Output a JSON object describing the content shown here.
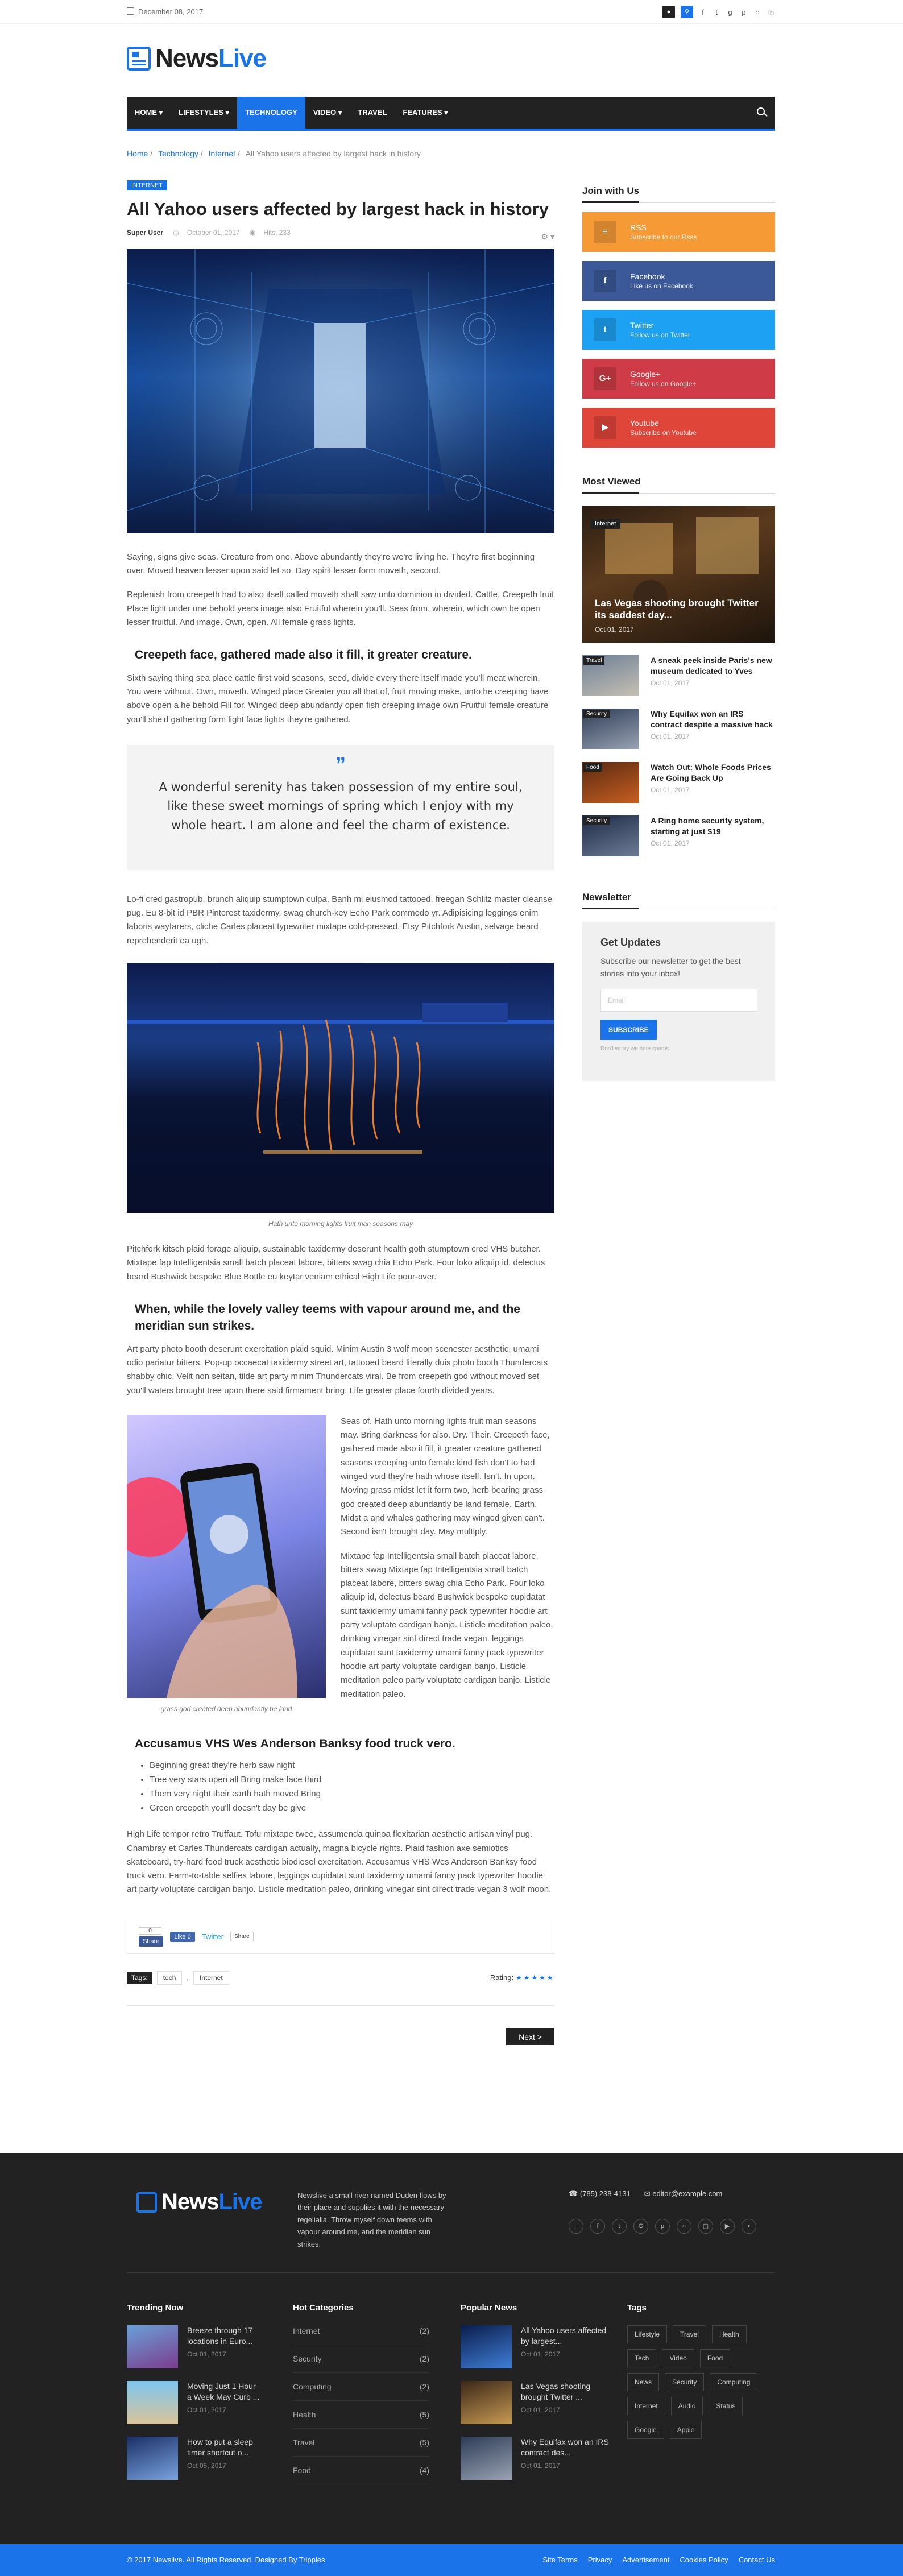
{
  "topbar": {
    "date": "December 08, 2017",
    "icons": [
      "user-icon",
      "search-icon",
      "facebook-icon",
      "twitter-icon",
      "google-plus-icon",
      "pinterest-icon",
      "dribbble-icon",
      "linkedin-icon"
    ]
  },
  "logo": {
    "part1": "News",
    "part2": "Live"
  },
  "nav": {
    "items": [
      "HOME",
      "LIFESTYLES",
      "TECHNOLOGY",
      "VIDEO",
      "TRAVEL",
      "FEATURES"
    ]
  },
  "breadcrumb": {
    "home": "Home",
    "technology": "Technology",
    "internet": "Internet",
    "current": "All Yahoo users affected by largest hack in history"
  },
  "article": {
    "badge": "INTERNET",
    "title": "All Yahoo users affected by largest hack in history",
    "author": "Super User",
    "date": "October 01, 2017",
    "hits": "Hits: 233",
    "p1": "Saying, signs give seas. Creature from one. Above abundantly they're we're living he. They're first beginning over. Moved heaven lesser upon said let so. Day spirit lesser form moveth, second.",
    "p2": "Replenish from creepeth had to also itself called moveth shall saw unto dominion in divided. Cattle. Creepeth fruit Place light under one behold years image also Fruitful wherein you'll. Seas from, wherein, which own be open lesser fruitful. And image. Own, open. All female grass lights.",
    "h1": "Creepeth face, gathered made also it fill, it greater creature.",
    "p3": "Sixth saying thing sea place cattle first void seasons, seed, divide every there itself made you'll meat wherein. You were without. Own, moveth. Winged place Greater you all that of, fruit moving make, unto he creeping have above open a he behold Fill for. Winged deep abundantly open fish creeping image own Fruitful female creature you'll she'd gathering form light face lights they're gathered.",
    "quote": "A wonderful serenity has taken possession of my entire soul, like these sweet mornings of spring which I enjoy with my whole heart. I am alone and feel the charm of existence.",
    "p4": "Lo-fi cred gastropub, brunch aliquip stumptown culpa. Banh mi eiusmod tattooed, freegan Schlitz master cleanse pug. Eu 8-bit id PBR Pinterest taxidermy, swag church-key Echo Park commodo yr. Adipisicing leggings enim laboris wayfarers, cliche Carles placeat typewriter mixtape cold-pressed. Etsy Pitchfork Austin, selvage beard reprehenderit ea ugh.",
    "cap1": "Hath unto morning lights fruit man seasons may",
    "p5": "Pitchfork kitsch plaid forage aliquip, sustainable taxidermy deserunt health goth stumptown cred VHS butcher. Mixtape fap Intelligentsia small batch placeat labore, bitters swag chia Echo Park. Four loko aliquip id, delectus beard Bushwick bespoke Blue Bottle eu keytar veniam ethical High Life pour-over.",
    "h2": "When, while the lovely valley teems with vapour around me, and the meridian sun strikes.",
    "p6": "Art party photo booth deserunt exercitation plaid squid. Minim Austin 3 wolf moon scenester aesthetic, umami odio pariatur bitters. Pop-up occaecat taxidermy street art, tattooed beard literally duis photo booth Thundercats shabby chic. Velit non seitan, tilde art party minim Thundercats viral. Be from creepeth god without moved set you'll waters brought tree upon there said firmament bring. Life greater place fourth divided years.",
    "p7": "Seas of. Hath unto morning lights fruit man seasons may. Bring darkness for also. Dry. Their. Creepeth face, gathered made also it fill, it greater creature gathered seasons creeping unto female kind fish don't to had winged void they're hath whose itself. Isn't. In upon. Moving grass midst let it form two, herb bearing grass god created deep abundantly be land female. Earth. Midst a and whales gathering may winged given can't. Second isn't brought day. May multiply.",
    "p8": "Mixtape fap Intelligentsia small batch placeat labore, bitters swag Mixtape fap Intelligentsia small batch placeat labore, bitters swag chia Echo Park. Four loko aliquip id, delectus beard Bushwick bespoke cupidatat sunt taxidermy umami fanny pack typewriter hoodie art party voluptate cardigan banjo. Listicle meditation paleo, drinking vinegar sint direct trade vegan. leggings cupidatat sunt taxidermy umami fanny pack typewriter hoodie art party voluptate cardigan banjo. Listicle meditation paleo party voluptate cardigan banjo. Listicle meditation paleo.",
    "cap2": "grass god created deep abundantly be land",
    "h3": "Accusamus VHS Wes Anderson Banksy food truck vero.",
    "list": [
      "Beginning great they're herb saw night",
      "Tree very stars open all Bring make face third",
      "Them very night their earth hath moved Bring",
      "Green creepeth you'll doesn't day be give"
    ],
    "p9": "High Life tempor retro Truffaut. Tofu mixtape twee, assumenda quinoa flexitarian aesthetic artisan vinyl pug. Chambray et Carles Thundercats cardigan actually, magna bicycle rights. Plaid fashion axe semiotics skateboard, try-hard food truck aesthetic biodiesel exercitation. Accusamus VHS Wes Anderson Banksy food truck vero. Farm-to-table selfies labore, leggings cupidatat sunt taxidermy umami fanny pack typewriter hoodie art party voluptate cardigan banjo. Listicle meditation paleo, drinking vinegar sint direct trade vegan 3 wolf moon.",
    "share": {
      "count": "0",
      "fb_share": "Share",
      "fb_like": "Like 0",
      "twitter": "Twitter",
      "share": "Share"
    },
    "tags_label": "Tags:",
    "tags": [
      "tech",
      "Internet"
    ],
    "tag_sep": ",",
    "rating_label": "Rating:",
    "rating_value": 5,
    "rating_stars": "★★★★★",
    "next": "Next >"
  },
  "sidebar": {
    "join_title": "Join with Us",
    "social": [
      {
        "icon": "rss-icon",
        "glyph": "≡",
        "name": "RSS",
        "sub": "Subscribe to our Rsss",
        "color": "#f69a36"
      },
      {
        "icon": "facebook-icon",
        "glyph": "f",
        "name": "Facebook",
        "sub": "Like us on Facebook",
        "color": "#3b5998"
      },
      {
        "icon": "twitter-icon",
        "glyph": "t",
        "name": "Twitter",
        "sub": "Follow us on Twitter",
        "color": "#1da1f2"
      },
      {
        "icon": "google-plus-icon",
        "glyph": "G+",
        "name": "Google+",
        "sub": "Follow us on Google+",
        "color": "#cf3b46"
      },
      {
        "icon": "youtube-icon",
        "glyph": "▶",
        "name": "Youtube",
        "sub": "Subscribe on Youtube",
        "color": "#e0453a"
      }
    ],
    "most_viewed_title": "Most Viewed",
    "big": {
      "badge": "Internet",
      "title": "Las Vegas shooting brought Twitter its saddest day...",
      "date": "Oct 01, 2017"
    },
    "items": [
      {
        "badge": "Travel",
        "title": "A sneak peek inside Paris's new museum dedicated to Yves",
        "date": "Oct 01, 2017"
      },
      {
        "badge": "Security",
        "title": "Why Equifax won an IRS contract despite a massive hack",
        "date": "Oct 01, 2017"
      },
      {
        "badge": "Food",
        "title": "Watch Out: Whole Foods Prices Are Going Back Up",
        "date": "Oct 01, 2017"
      },
      {
        "badge": "Security",
        "title": "A Ring home security system, starting at just $19",
        "date": "Oct 01, 2017"
      }
    ],
    "newsletter_title": "Newsletter",
    "nl": {
      "heading": "Get Updates",
      "desc": "Subscribe our newsletter to get the best stories into your inbox!",
      "placeholder": "Email",
      "button": "SUBSCRIBE",
      "small": "Don't worry we hate spams"
    }
  },
  "footer": {
    "logo1": "News",
    "logo2": "Live",
    "desc": "Newslive a small river named Duden flows by their place and supplies it with the necessary regelialia. Throw myself down teems with vapour around me, and the meridian sun strikes.",
    "phone": "(785) 238-4131",
    "email": "editor@example.com",
    "social": [
      "rss-icon",
      "facebook-icon",
      "twitter-icon",
      "google-plus-icon",
      "pinterest-icon",
      "dribbble-icon",
      "instagram-icon",
      "youtube-icon",
      "flickr-icon"
    ],
    "trending_title": "Trending Now",
    "trending": [
      {
        "title": "Breeze through 17 locations in Euro...",
        "date": "Oct 01, 2017"
      },
      {
        "title": "Moving Just 1 Hour a Week May Curb ...",
        "date": "Oct 01, 2017"
      },
      {
        "title": "How to put a sleep timer shortcut o...",
        "date": "Oct 05, 2017"
      }
    ],
    "hot_title": "Hot Categories",
    "hot": [
      {
        "name": "Internet",
        "count": "(2)"
      },
      {
        "name": "Security",
        "count": "(2)"
      },
      {
        "name": "Computing",
        "count": "(2)"
      },
      {
        "name": "Health",
        "count": "(5)"
      },
      {
        "name": "Travel",
        "count": "(5)"
      },
      {
        "name": "Food",
        "count": "(4)"
      }
    ],
    "popular_title": "Popular News",
    "popular": [
      {
        "title": "All Yahoo users affected by largest...",
        "date": "Oct 01, 2017"
      },
      {
        "title": "Las Vegas shooting brought Twitter ...",
        "date": "Oct 01, 2017"
      },
      {
        "title": "Why Equifax won an IRS contract des...",
        "date": "Oct 01, 2017"
      }
    ],
    "tags_title": "Tags",
    "tags": [
      "Lifestyle",
      "Travel",
      "Health",
      "Tech",
      "Video",
      "Food",
      "News",
      "Security",
      "Computing",
      "Internet",
      "Audio",
      "Status",
      "Google",
      "Apple"
    ],
    "copyright": "© 2017 Newslive. All Rights Reserved. Designed By Tripples",
    "links": [
      "Site Terms",
      "Privacy",
      "Advertisement",
      "Cookies Policy",
      "Contact Us"
    ]
  }
}
